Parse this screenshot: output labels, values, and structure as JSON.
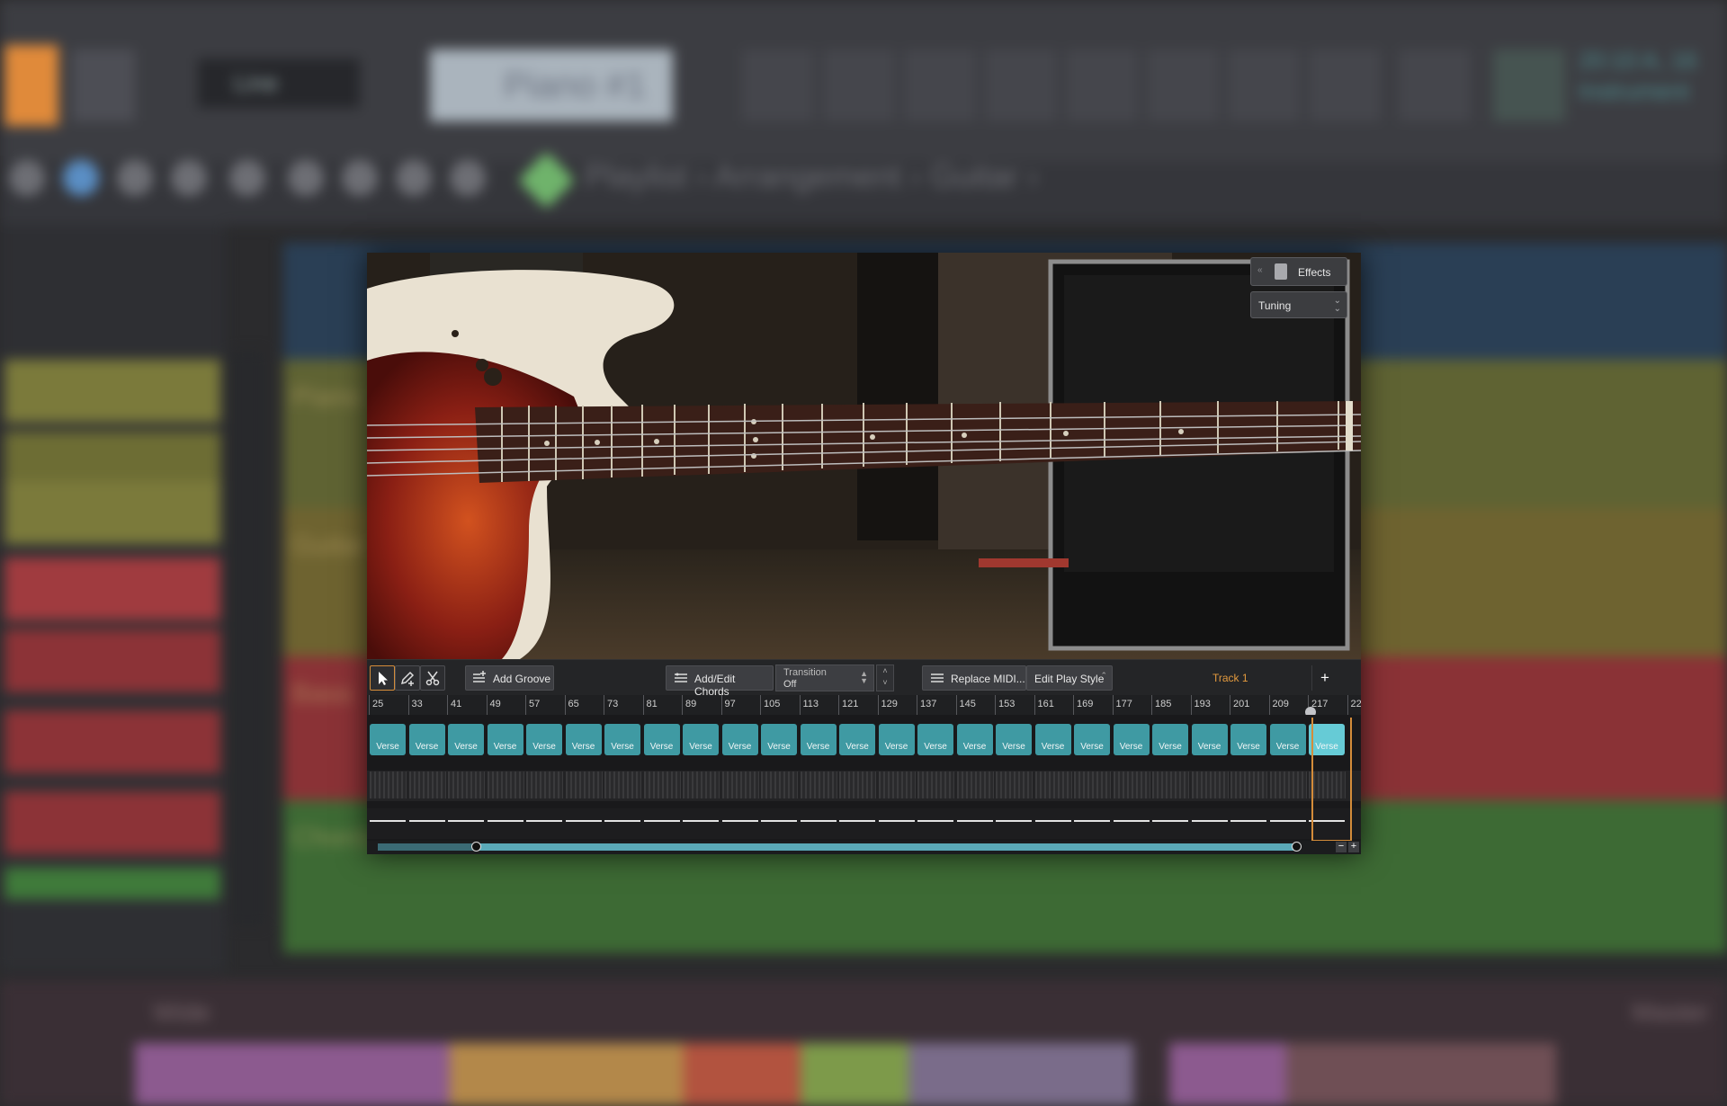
{
  "background": {
    "pattern_selector": "Line",
    "instrument_display": "Piano #1",
    "info": [
      "20:10 A, 16",
      "Instrument"
    ],
    "breadcrumb": "Playlist › Arrangement › Guitar ›",
    "tracks": [
      "Piano",
      "Guitar",
      "Bass",
      "Chords"
    ],
    "mixer_label": "Wide",
    "master_label": "Master"
  },
  "plugin": {
    "effects_label": "Effects",
    "tuning_label": "Tuning",
    "toolbar": {
      "add_groove": "Add Groove",
      "add_edit_chords": "Add/Edit Chords",
      "transition_label": "Transition",
      "transition_value": "Off",
      "replace_midi": "Replace MIDI...",
      "edit_play_style": "Edit Play Style",
      "track_name": "Track 1",
      "add": "+"
    },
    "ruler_ticks": [
      "25",
      "33",
      "41",
      "49",
      "57",
      "65",
      "73",
      "81",
      "89",
      "97",
      "105",
      "113",
      "121",
      "129",
      "137",
      "145",
      "153",
      "161",
      "169",
      "177",
      "185",
      "193",
      "201",
      "209",
      "217",
      "22"
    ],
    "section_label": "Verse",
    "section_count": 25,
    "selected_section_index": 24,
    "zoom_out": "−",
    "zoom_in": "+"
  },
  "colors": {
    "section": "#3f9aa3",
    "section_selected": "#66cbd6",
    "loop": "#d48c3a",
    "track_name": "#e39a3e"
  }
}
